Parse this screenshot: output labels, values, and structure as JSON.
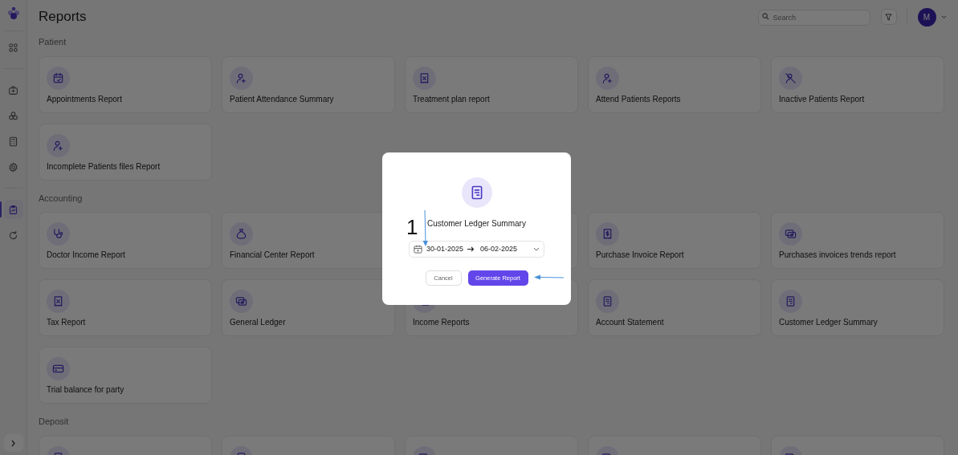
{
  "sidebar": {
    "items": [
      {
        "kind": "grid",
        "selected": false
      },
      {
        "kind": "medkit",
        "selected": false
      },
      {
        "kind": "cubes",
        "selected": false
      },
      {
        "kind": "calculator",
        "selected": false
      },
      {
        "kind": "gear",
        "selected": false
      },
      {
        "kind": "clipboard",
        "selected": true
      },
      {
        "kind": "refresh",
        "selected": false
      }
    ]
  },
  "header": {
    "title": "Reports",
    "search": {
      "placeholder": "Search"
    },
    "avatar": "M"
  },
  "sections": [
    {
      "title": "Patient",
      "cards": [
        {
          "kind": "calendar",
          "label": "Appointments Report"
        },
        {
          "kind": "user-plus",
          "label": "Patient Attendance Summary"
        },
        {
          "kind": "receipt-x",
          "label": "Treatment plan report"
        },
        {
          "kind": "user-plus",
          "label": "Attend Patients Reports"
        },
        {
          "kind": "user-off",
          "label": "Inactive Patients Report"
        },
        {
          "kind": "user-plus",
          "label": "Incomplete Patients files Report"
        }
      ]
    },
    {
      "title": "Accounting",
      "cards": [
        {
          "kind": "stethoscope",
          "label": "Doctor Income Report"
        },
        {
          "kind": "bag",
          "label": "Financial Center Report"
        },
        {
          "kind": "blank"
        },
        {
          "kind": "dollar",
          "label": "Purchase Invoice Report"
        },
        {
          "kind": "cash",
          "label": "Purchases invoices trends report"
        },
        {
          "kind": "receipt-x",
          "label": "Tax Report"
        },
        {
          "kind": "cash",
          "label": "General Ledger"
        },
        {
          "kind": "cash",
          "label": "Income Reports"
        },
        {
          "kind": "doc",
          "label": "Account Statement"
        },
        {
          "kind": "doc",
          "label": "Customer Ledger Summary"
        },
        {
          "kind": "card",
          "label": "Trial balance for party"
        }
      ]
    },
    {
      "title": "Deposit",
      "cards": [
        {
          "kind": "doc"
        },
        {
          "kind": "doc"
        },
        {
          "kind": "cash"
        },
        {
          "kind": "cash"
        },
        {
          "kind": "cash"
        }
      ]
    }
  ],
  "modal": {
    "title": "Customer Ledger Summary",
    "date_from": "30-01-2025",
    "date_to": "06-02-2025",
    "cancel": "Cancel",
    "generate": "Generate Report"
  },
  "annotation": {
    "number": "1"
  }
}
